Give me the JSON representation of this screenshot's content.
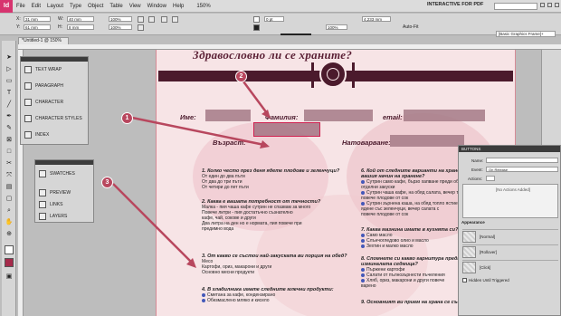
{
  "app": {
    "logo": "Id",
    "zoom": "150%",
    "workspace": "INTERACTIVE FOR PDF",
    "menu": [
      "File",
      "Edit",
      "Layout",
      "Type",
      "Object",
      "Table",
      "View",
      "Window",
      "Help"
    ]
  },
  "control": {
    "x": "31 mm",
    "y": "61 mm",
    "w": "40 mm",
    "h": "8 mm",
    "zoom_h": "100%",
    "zoom_v": "100%",
    "stroke": "0 pt",
    "pct": "100%",
    "mm": "4,233 mm",
    "autofit": "Auto-Fit",
    "frame_style": "[Basic Graphics Frame]+"
  },
  "document": {
    "tab": "*Untitled-1 @ 150%"
  },
  "page": {
    "title": "Здравословно ли се храните?",
    "labels": {
      "name": "Име:",
      "surname": "Фамилия:",
      "email": "email:",
      "age": "Възраст:",
      "birth": "Натоварване:"
    },
    "left_questions": [
      {
        "q": "1. Колко често през деня ядете плодове и зеленчуци?",
        "answers": [
          "От един до два пъти",
          "От два до три пъти",
          "От четири до пет пъти"
        ]
      },
      {
        "q": "2. Каква е вашата потребност от течности?",
        "answers": [
          "Малка - пия чаша кафе сутрин не спазвам за много",
          "Повече литри - пия достатъчно съзнателно",
          "кафе, чай, сокове и други",
          "Два литра на ден но е нормата, пия повече при",
          "предимно вода"
        ]
      },
      {
        "q": "3. От какво се състои най-закуската ви порция на обед?",
        "answers": [
          "Месо",
          "Картофи, ориз, макарони и други",
          "Основно месни продукти"
        ]
      },
      {
        "q": "4. В хладилника имате следните млечни продукти:",
        "answers": [
          "Сметана за кафе, кондензирано",
          "Обезмаслено мляко и кисело"
        ]
      }
    ],
    "right_questions": [
      {
        "q": "6. Кой от следните варианти на хранене подхожда на вашия начин на хранене?",
        "answers": [
          "Сутрин само кафе, бързо хапване преди обяд, след това",
          "отделни закуски",
          "Сутрин чаша кафе, на обяд салата, вечер топла храна",
          "повече плодове от сок",
          "Сутрин зърнена каша, на обяд топло ястие, вечер",
          "ядене със зеленчуци, вечер салата с",
          "повече плодове от сок"
        ]
      },
      {
        "q": "7. Каква мазнина имате в кухнята си?",
        "answers": [
          "Само масло",
          "Слънчогледово олио и масло",
          "Зехтин и малко масло"
        ]
      },
      {
        "q": "8. Спомнете си какво гарнитура предпочитат през изминалата седмица?",
        "answers": [
          "Пържени картофи",
          "Салати от пълнозърнести пъчеления",
          "Хляб, ориз, макарони и други повече",
          "варено"
        ]
      },
      {
        "q": "9. Основният ви прием на храна се състои от:",
        "answers": []
      }
    ]
  },
  "panels": {
    "group1": [
      "TEXT WRAP",
      "PARAGRAPH",
      "CHARACTER",
      "CHARACTER STYLES",
      "INDEX"
    ],
    "group2": [
      "SWATCHES",
      "PREVIEW",
      "LINKS",
      "LAYERS"
    ]
  },
  "callouts": [
    "1",
    "2",
    "3"
  ],
  "buttons_panel": {
    "title": "BUTTONS",
    "name_label": "Name:",
    "event_label": "Event:",
    "event_value": "On Release",
    "actions_label": "Actions:",
    "no_actions": "[No Actions Added]",
    "appearance_label": "Appearance",
    "states": [
      "[Normal]",
      "[Rollover]",
      "[Click]"
    ],
    "hidden_label": "Hidden Until Triggered"
  },
  "colors": {
    "accent": "#b8475e",
    "banner": "#4b1a2c",
    "page": "#f7e4e6",
    "field": "#a57a86"
  }
}
